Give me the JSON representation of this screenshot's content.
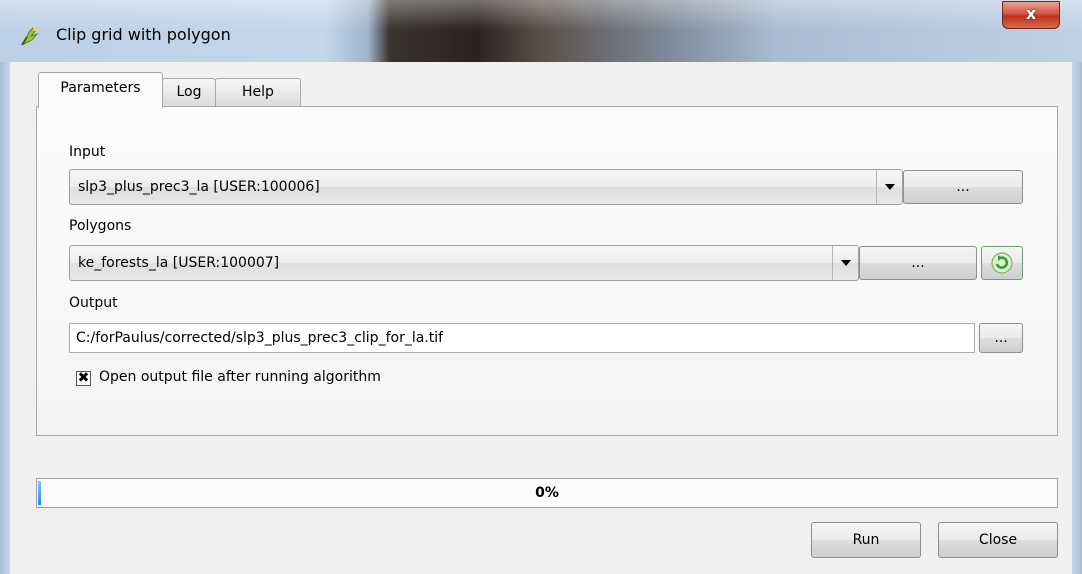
{
  "window": {
    "title": "Clip grid with polygon",
    "close_glyph": "x",
    "app_icon": "qgis-processing-icon"
  },
  "tabs": [
    {
      "label": "Parameters",
      "active": true
    },
    {
      "label": "Log",
      "active": false
    },
    {
      "label": "Help",
      "active": false
    }
  ],
  "params": {
    "input": {
      "label": "Input",
      "selected": "slp3_plus_prec3_la [USER:100006]",
      "browse_label": "..."
    },
    "polygons": {
      "label": "Polygons",
      "selected": "ke_forests_la [USER:100007]",
      "browse_label": "...",
      "iterate_icon": "green-refresh-icon"
    },
    "output": {
      "label": "Output",
      "value": "C:/forPaulus/corrected/slp3_plus_prec3_clip_for_la.tif",
      "browse_label": "..."
    },
    "open_output": {
      "label": "Open output file after running algorithm",
      "checked": true,
      "mark": "✖"
    }
  },
  "progress": {
    "value": 0,
    "text": "0%"
  },
  "buttons": {
    "run": "Run",
    "close": "Close"
  },
  "colors": {
    "progress_fill": "#1f8de9",
    "close_button": "#c0321c",
    "iterate_icon": "#2e9b2e"
  }
}
